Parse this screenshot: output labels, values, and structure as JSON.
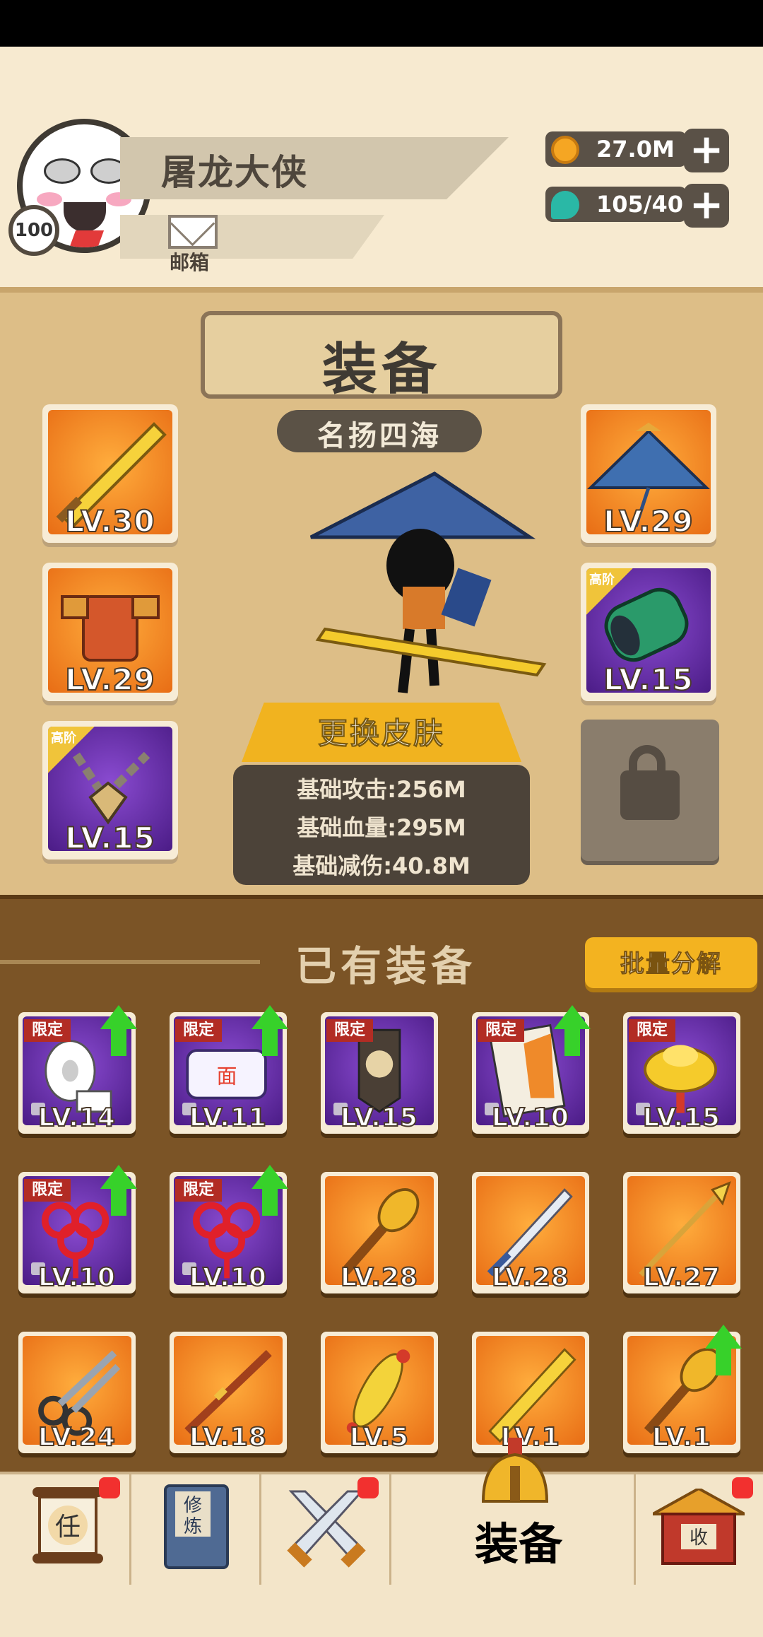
{
  "header": {
    "player_name": "屠龙大侠",
    "level": "100",
    "mail_label": "邮箱",
    "currencies": [
      {
        "icon": "coin-icon",
        "value": "27.0M",
        "color": "#f5a623"
      },
      {
        "icon": "jade-icon",
        "value": "105/40",
        "color": "#2ab8a6"
      }
    ]
  },
  "equipment": {
    "title": "装备",
    "honor_title": "名扬四海",
    "skin_button": "更换皮肤",
    "stats": [
      "基础攻击:256M",
      "基础血量:295M",
      "基础减伤:40.8M"
    ],
    "left_slots": [
      {
        "icon": "golden-sword-icon",
        "level": "LV.30",
        "rarity": "orange",
        "tag": ""
      },
      {
        "icon": "armor-icon",
        "level": "LV.29",
        "rarity": "orange",
        "tag": ""
      },
      {
        "icon": "necklace-icon",
        "level": "LV.15",
        "rarity": "purple",
        "tag": "高阶"
      }
    ],
    "right_slots": [
      {
        "icon": "bamboo-hat-icon",
        "level": "LV.29",
        "rarity": "orange",
        "tag": ""
      },
      {
        "icon": "jade-bracer-icon",
        "level": "LV.15",
        "rarity": "purple",
        "tag": "高阶"
      },
      {
        "icon": "lock-icon",
        "level": "",
        "rarity": "locked",
        "tag": ""
      }
    ]
  },
  "owned": {
    "title": "已有装备",
    "batch_button": "批量分解",
    "limited_label": "限定",
    "items": [
      {
        "icon": "toilet-paper-icon",
        "level": "LV.14",
        "rarity": "purple",
        "limited": true,
        "upgrade": true
      },
      {
        "icon": "instant-noodles-icon",
        "level": "LV.11",
        "rarity": "purple",
        "limited": true,
        "upgrade": true
      },
      {
        "icon": "token-plaque-icon",
        "level": "LV.15",
        "rarity": "purple",
        "limited": true,
        "upgrade": false
      },
      {
        "icon": "manga-book-icon",
        "level": "LV.10",
        "rarity": "purple",
        "limited": true,
        "upgrade": true
      },
      {
        "icon": "gold-ingot-icon",
        "level": "LV.15",
        "rarity": "purple",
        "limited": true,
        "upgrade": false
      },
      {
        "icon": "chinese-knot-icon",
        "level": "LV.10",
        "rarity": "purple",
        "limited": true,
        "upgrade": true
      },
      {
        "icon": "chinese-knot-icon",
        "level": "LV.10",
        "rarity": "purple",
        "limited": true,
        "upgrade": true
      },
      {
        "icon": "mace-icon",
        "level": "LV.28",
        "rarity": "orange",
        "limited": false,
        "upgrade": false
      },
      {
        "icon": "sword-icon",
        "level": "LV.28",
        "rarity": "orange",
        "limited": false,
        "upgrade": false
      },
      {
        "icon": "spear-icon",
        "level": "LV.27",
        "rarity": "orange",
        "limited": false,
        "upgrade": false
      },
      {
        "icon": "scissors-icon",
        "level": "LV.24",
        "rarity": "orange",
        "limited": false,
        "upgrade": false
      },
      {
        "icon": "staff-icon",
        "level": "LV.18",
        "rarity": "orange",
        "limited": false,
        "upgrade": false
      },
      {
        "icon": "rubber-chicken-icon",
        "level": "LV.5",
        "rarity": "orange",
        "limited": false,
        "upgrade": false
      },
      {
        "icon": "golden-sword-icon",
        "level": "LV.1",
        "rarity": "orange",
        "limited": false,
        "upgrade": false
      },
      {
        "icon": "mace-icon",
        "level": "LV.1",
        "rarity": "orange",
        "limited": false,
        "upgrade": true
      }
    ]
  },
  "nav": {
    "items": [
      {
        "icon": "quest-scroll-icon",
        "label": "任",
        "badge": true
      },
      {
        "icon": "cultivation-book-icon",
        "label": "修炼",
        "badge": false
      },
      {
        "icon": "crossed-swords-icon",
        "label": "",
        "badge": true
      },
      {
        "icon": "equipment-helmet-icon",
        "label": "装备",
        "badge": false
      },
      {
        "icon": "shop-collect-icon",
        "label": "收",
        "badge": true
      }
    ]
  }
}
